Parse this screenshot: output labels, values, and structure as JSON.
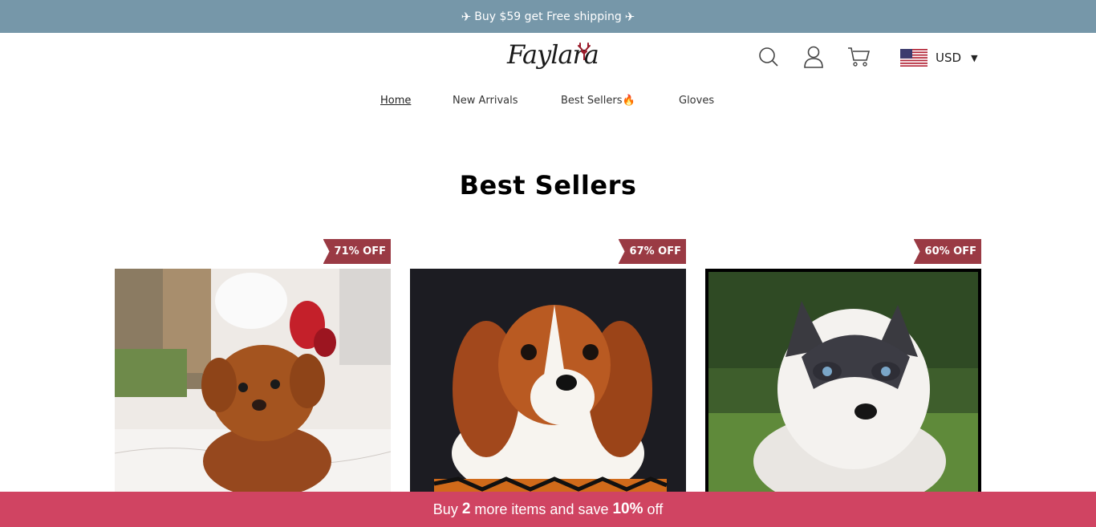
{
  "announcement": {
    "text": "Buy $59 get Free shipping",
    "icon": "airplane-icon"
  },
  "header": {
    "logo_text": "Faylara",
    "currency": {
      "label": "USD",
      "flag": "us-flag-icon"
    },
    "icons": [
      "search-icon",
      "account-icon",
      "cart-icon"
    ]
  },
  "nav": {
    "items": [
      {
        "label": "Home",
        "active": true
      },
      {
        "label": "New Arrivals"
      },
      {
        "label": "Best Sellers🔥"
      },
      {
        "label": "Gloves"
      }
    ]
  },
  "section": {
    "title": "Best Sellers"
  },
  "products": [
    {
      "badge": "71% OFF",
      "image": "poodle-puppy"
    },
    {
      "badge": "67% OFF",
      "image": "cavalier-puppy"
    },
    {
      "badge": "60% OFF",
      "image": "husky-puppy"
    }
  ],
  "promo_bar": {
    "prefix": "Buy",
    "count": "2",
    "middle": "more items and save",
    "discount": "10%",
    "suffix": "off"
  },
  "colors": {
    "announce_bg": "#7697a9",
    "badge_bg": "#9a3a44",
    "promo_bg": "#d04462"
  }
}
